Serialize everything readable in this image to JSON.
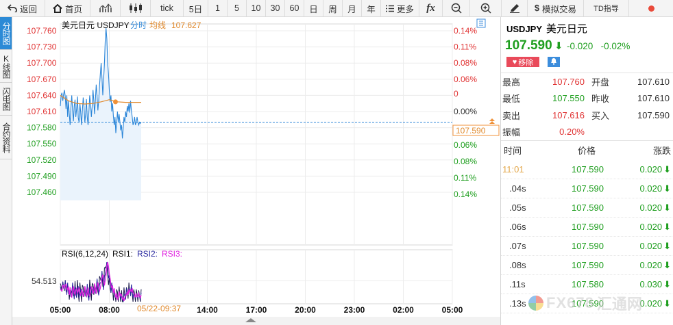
{
  "toolbar": {
    "back": "返回",
    "home": "首页",
    "tick": "tick",
    "five_day": "5日",
    "periods": [
      "1",
      "5",
      "10",
      "30",
      "60"
    ],
    "day": "日",
    "week": "周",
    "month": "月",
    "year": "年",
    "more": "更多",
    "fx": "fx",
    "simulate": "模拟交易",
    "td": "TD指导"
  },
  "side_tabs": [
    "分时图",
    "K线图",
    "闪电图",
    "合约资料"
  ],
  "chart": {
    "symbol_label": "美元日元 USDJPY",
    "mode_label": "分时",
    "avg_label": "均线",
    "avg_value": "107.627",
    "rsi_label": "RSI(6,12,24)",
    "rsi1": "RSI1:",
    "rsi2": "RSI2:",
    "rsi3": "RSI3:",
    "rsi_tick": "54.513",
    "current_price": "107.590",
    "cursor_time": "05/22-09:37",
    "colors": {
      "up": "#e03232",
      "down": "#1e9e1e",
      "price_line": "#2c86d8",
      "avg_line": "#e0892c",
      "rsi1": "#1a1a4a",
      "rsi2": "#2a2aa0",
      "rsi3": "#e020e0"
    }
  },
  "chart_data": {
    "type": "line",
    "title": "美元日元 USDJPY",
    "y_ticks": [
      "107.760",
      "107.730",
      "107.700",
      "107.670",
      "107.640",
      "107.610",
      "107.580",
      "107.550",
      "107.520",
      "107.490",
      "107.460"
    ],
    "pct_ticks": [
      "0.14%",
      "0.11%",
      "0.08%",
      "0.06%",
      "0",
      "0.00%",
      "0.06%",
      "0.08%",
      "0.11%",
      "0.14%"
    ],
    "x_ticks": [
      "05:00",
      "08:00",
      "14:00",
      "17:00",
      "20:00",
      "23:00",
      "02:00",
      "05:00"
    ],
    "ylim": [
      107.445,
      107.775
    ],
    "series": [
      {
        "name": "分时",
        "x_minutes": [
          0,
          3,
          6,
          9,
          12,
          15,
          18,
          21,
          24,
          27,
          30,
          33,
          36,
          39,
          42,
          45,
          48,
          51,
          54,
          57,
          60,
          63,
          66,
          69,
          72,
          75,
          78,
          81,
          84,
          87,
          90,
          93,
          96,
          99,
          102,
          105,
          108,
          111,
          114,
          117,
          120,
          123,
          126,
          129,
          132,
          135,
          138,
          141,
          144,
          147,
          150,
          153,
          156,
          159,
          162,
          165,
          168,
          171,
          174,
          177,
          180,
          183,
          186,
          189,
          192,
          195,
          198,
          201,
          204,
          207,
          210,
          213,
          216,
          219,
          222,
          225,
          228,
          231,
          234,
          237,
          240,
          243,
          246,
          249,
          252,
          255,
          258,
          261,
          264,
          267,
          270,
          273,
          276,
          279,
          282,
          285,
          288,
          291,
          294,
          297
        ],
        "values": [
          107.62,
          107.64,
          107.645,
          107.63,
          107.642,
          107.65,
          107.638,
          107.615,
          107.64,
          107.6,
          107.63,
          107.605,
          107.585,
          107.618,
          107.64,
          107.612,
          107.592,
          107.62,
          107.632,
          107.6,
          107.615,
          107.638,
          107.598,
          107.59,
          107.625,
          107.608,
          107.585,
          107.612,
          107.636,
          107.62,
          107.59,
          107.605,
          107.633,
          107.6,
          107.585,
          107.61,
          107.64,
          107.625,
          107.6,
          107.62,
          107.65,
          107.63,
          107.605,
          107.632,
          107.66,
          107.64,
          107.612,
          107.63,
          107.658,
          107.68,
          107.7,
          107.672,
          107.64,
          107.67,
          107.7,
          107.74,
          107.765,
          107.745,
          107.7,
          107.68,
          107.65,
          107.628,
          107.64,
          107.61,
          107.625,
          107.6,
          107.585,
          107.6,
          107.57,
          107.59,
          107.61,
          107.59,
          107.605,
          107.59,
          107.575,
          107.585,
          107.56,
          107.58,
          107.6,
          107.59,
          107.61,
          107.6,
          107.62,
          107.61,
          107.625,
          107.608,
          107.63,
          107.612,
          107.6,
          107.585,
          107.59,
          107.6,
          107.585,
          107.59,
          107.6,
          107.59,
          107.585,
          107.59,
          107.588,
          107.59
        ]
      },
      {
        "name": "均线",
        "x_minutes": [
          0,
          30,
          60,
          90,
          120,
          150,
          180,
          210,
          240,
          270,
          297
        ],
        "values": [
          107.64,
          107.63,
          107.625,
          107.624,
          107.625,
          107.628,
          107.632,
          107.628,
          107.627,
          107.627,
          107.627
        ]
      }
    ]
  },
  "quote": {
    "code": "USDJPY",
    "name": "美元日元",
    "price": "107.590",
    "change": "-0.020",
    "change_pct": "-0.02%",
    "remove_label": "移除",
    "rows": [
      {
        "k": "最高",
        "v": "107.760",
        "k2": "开盘",
        "v2": "107.610",
        "color": "red"
      },
      {
        "k": "最低",
        "v": "107.550",
        "k2": "昨收",
        "v2": "107.610",
        "color": "green"
      },
      {
        "k": "卖出",
        "v": "107.616",
        "k2": "买入",
        "v2": "107.590",
        "color": "red"
      },
      {
        "k": "振幅",
        "v": "0.20%",
        "k2": "",
        "v2": "",
        "color": "red"
      }
    ]
  },
  "ticks": {
    "headers": [
      "时间",
      "价格",
      "涨跌"
    ],
    "rows": [
      {
        "time": "11:01",
        "price": "107.590",
        "change": "0.020"
      },
      {
        "time": ".04s",
        "price": "107.590",
        "change": "0.020"
      },
      {
        "time": ".05s",
        "price": "107.590",
        "change": "0.020"
      },
      {
        "time": ".06s",
        "price": "107.590",
        "change": "0.020"
      },
      {
        "time": ".07s",
        "price": "107.590",
        "change": "0.020"
      },
      {
        "time": ".08s",
        "price": "107.590",
        "change": "0.020"
      },
      {
        "time": ".11s",
        "price": "107.580",
        "change": "0.030"
      },
      {
        "time": ".13s",
        "price": "107.590",
        "change": "0.020"
      }
    ]
  },
  "watermark": {
    "text": "FX678",
    "cn": "汇通网"
  }
}
